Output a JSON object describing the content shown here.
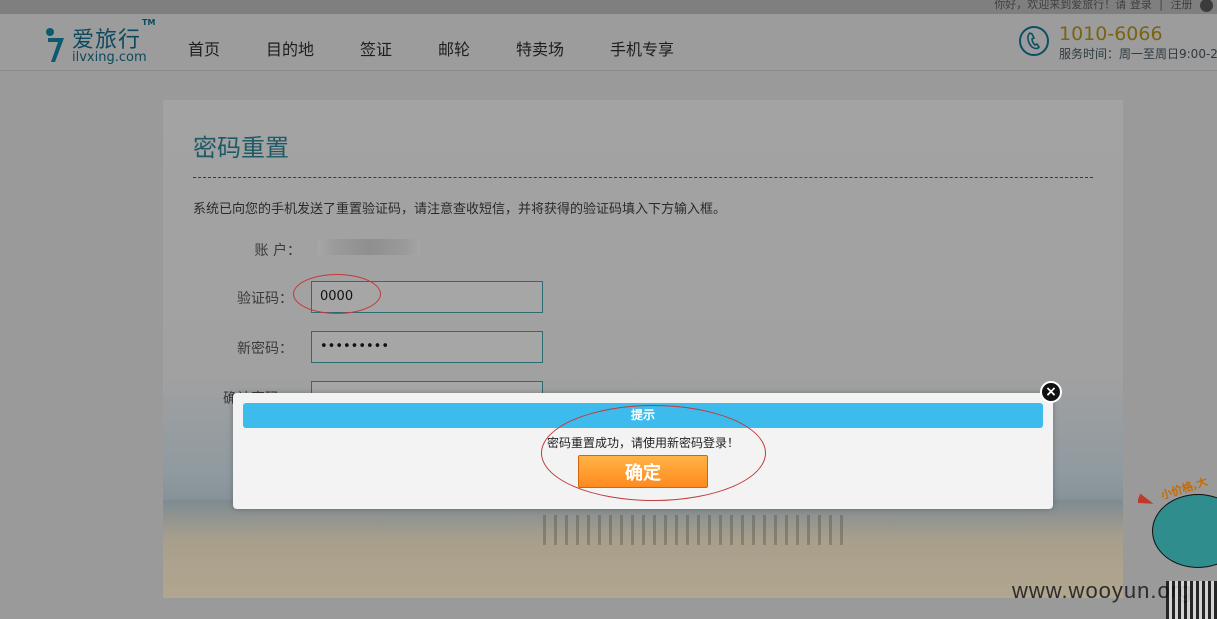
{
  "topbar": {
    "welcome": "你好，欢迎来到爱旅行！请",
    "login": "登录",
    "sep": "|",
    "register": "注册"
  },
  "header": {
    "logo_name": "爱旅行",
    "logo_tm": "TM",
    "logo_domain": "ilvxing.com",
    "nav": [
      "首页",
      "目的地",
      "签证",
      "邮轮",
      "特卖场",
      "手机专享"
    ],
    "phone": "1010-6066",
    "service_hours": "服务时间：周一至周日9:00-2"
  },
  "form": {
    "title": "密码重置",
    "description": "系统已向您的手机发送了重置验证码，请注意查收短信，并将获得的验证码填入下方输入框。",
    "account_label": "账 户：",
    "code_label": "验证码：",
    "code_value": "0000",
    "new_password_label": "新密码：",
    "new_password_value": "•••••••••",
    "confirm_password_label": "确认密码："
  },
  "dialog": {
    "title": "提示",
    "message": "密码重置成功，请使用新密码登录！",
    "ok_label": "确定",
    "close_glyph": "×"
  },
  "promo": {
    "text": "小价格,大"
  },
  "watermark": "www.wooyun.org",
  "colors": {
    "dialog_header": "#3dbbec",
    "ok_button": "#ff8a1e",
    "annotation": "#c23a3a"
  }
}
